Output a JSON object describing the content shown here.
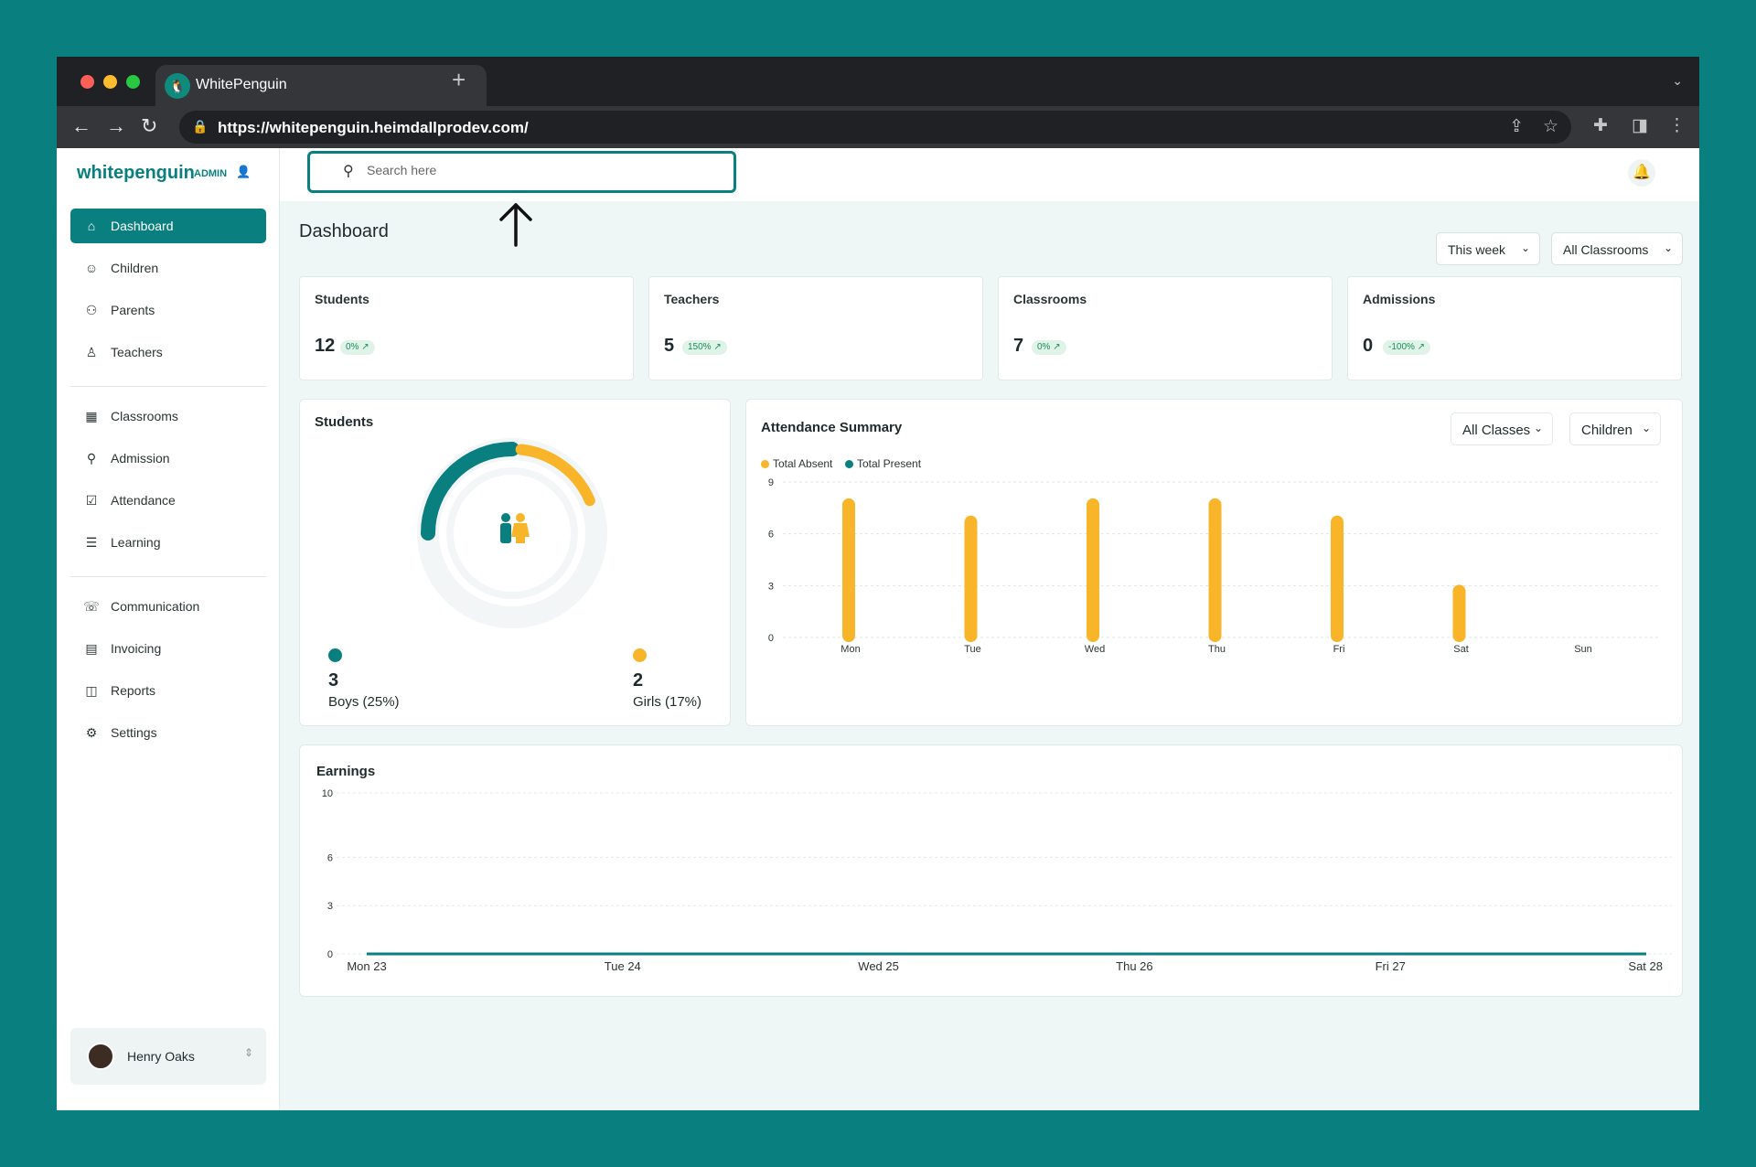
{
  "browser": {
    "tab_title": "WhitePenguin",
    "url": "https://whitepenguin.heimdallprodev.com/"
  },
  "sidebar": {
    "logo": "whitepenguin",
    "badge": "ADMIN",
    "items": [
      {
        "label": "Dashboard",
        "icon": "home-icon"
      },
      {
        "label": "Children",
        "icon": "child-icon"
      },
      {
        "label": "Parents",
        "icon": "users-icon"
      },
      {
        "label": "Teachers",
        "icon": "teacher-icon"
      },
      {
        "label": "Classrooms",
        "icon": "grid-icon"
      },
      {
        "label": "Admission",
        "icon": "user-add-icon"
      },
      {
        "label": "Attendance",
        "icon": "check-icon"
      },
      {
        "label": "Learning",
        "icon": "book-icon"
      },
      {
        "label": "Communication",
        "icon": "chat-icon"
      },
      {
        "label": "Invoicing",
        "icon": "invoice-icon"
      },
      {
        "label": "Reports",
        "icon": "reports-icon"
      },
      {
        "label": "Settings",
        "icon": "gear-icon"
      }
    ],
    "user": {
      "name": "Henry Oaks"
    }
  },
  "search": {
    "placeholder": "Search here"
  },
  "dashboard": {
    "title": "Dashboard",
    "filters": {
      "period": "This week",
      "classrooms": "All Classrooms"
    },
    "stats": [
      {
        "title": "Students",
        "value": "12",
        "change": "0% ↗"
      },
      {
        "title": "Teachers",
        "value": "5",
        "change": "150% ↗"
      },
      {
        "title": "Classrooms",
        "value": "7",
        "change": "0% ↗"
      },
      {
        "title": "Admissions",
        "value": "0",
        "change": "-100% ↗"
      }
    ],
    "students": {
      "title": "Students",
      "boys": {
        "value": "3",
        "label": "Boys (25%)",
        "color": "#0a7f7f"
      },
      "girls": {
        "value": "2",
        "label": "Girls (17%)",
        "color": "#f9b52a"
      }
    },
    "attendance": {
      "title": "Attendance Summary",
      "filter_class": "All Classes",
      "filter_group": "Children"
    },
    "earnings": {
      "title": "Earnings"
    }
  },
  "colors": {
    "accent": "#0a7f7f",
    "absent": "#f9b52a",
    "present": "#0a7f7f"
  },
  "chart_data": [
    {
      "type": "bar",
      "title": "Attendance Summary",
      "categories": [
        "Mon",
        "Tue",
        "Wed",
        "Thu",
        "Fri",
        "Sat",
        "Sun"
      ],
      "series": [
        {
          "name": "Total Absent",
          "values": [
            8,
            7,
            8,
            8,
            7,
            3,
            0
          ]
        },
        {
          "name": "Total Present",
          "values": [
            0,
            0,
            0,
            0,
            0,
            0,
            0
          ]
        }
      ],
      "yticks": [
        0,
        3,
        6,
        9
      ],
      "ylim": [
        0,
        9
      ]
    },
    {
      "type": "line",
      "title": "Earnings",
      "categories": [
        "Mon 23",
        "Tue 24",
        "Wed 25",
        "Thu 26",
        "Fri 27",
        "Sat 28"
      ],
      "values": [
        0,
        0,
        0,
        0,
        0,
        0
      ],
      "yticks": [
        0,
        3,
        6,
        10
      ],
      "ylim": [
        0,
        10
      ]
    },
    {
      "type": "pie",
      "title": "Students",
      "categories": [
        "Boys",
        "Girls"
      ],
      "values": [
        25,
        17
      ]
    }
  ]
}
